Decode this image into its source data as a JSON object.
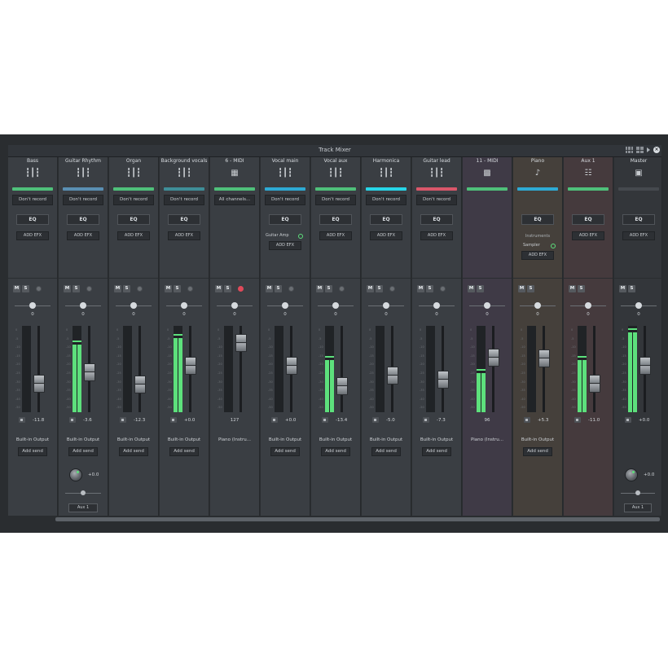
{
  "window": {
    "title": "Track Mixer"
  },
  "colors": {
    "accent_green": "#5de07c",
    "window_bg": "#2a2d30",
    "strip_bg": "#3a3e43"
  },
  "strips": [
    {
      "name": "Bass",
      "icon": "waveform-icon",
      "color": "#4fc07a",
      "record": "Don't record",
      "efx": [],
      "add_efx": "ADD EFX",
      "pan": "0",
      "volume": "-11.8",
      "fader_pos": 0.3,
      "meter_level": 0.0,
      "output": "Built-in Output",
      "add_send": "Add send"
    },
    {
      "name": "Guitar Rhythm",
      "icon": "waveform-icon",
      "color": "#5a8fb3",
      "record": "Don't record",
      "efx": [],
      "add_efx": "ADD EFX",
      "pan": "0",
      "volume": "-3.6",
      "fader_pos": 0.47,
      "meter_level": 0.78,
      "output": "Built-in Output",
      "add_send": "Add send",
      "aux_send": {
        "value": "+0.0",
        "destination": "Aux 1"
      }
    },
    {
      "name": "Organ",
      "icon": "waveform-icon",
      "color": "#4fc07a",
      "record": "Don't record",
      "efx": [],
      "add_efx": "ADD EFX",
      "pan": "0",
      "volume": "-12.3",
      "fader_pos": 0.29,
      "meter_level": 0.0,
      "output": "Built-in Output",
      "add_send": "Add send"
    },
    {
      "name": "Background vocals",
      "icon": "waveform-icon",
      "color": "#3f8e98",
      "record": "Don't record",
      "efx": [],
      "add_efx": "ADD EFX",
      "pan": "0",
      "volume": "+0.0",
      "fader_pos": 0.56,
      "meter_level": 0.86,
      "output": "Built-in Output",
      "add_send": "Add send"
    },
    {
      "name": "6 - MIDI",
      "icon": "piano-keys-icon",
      "color": "#4fc07a",
      "record": "All channels...",
      "efx": [],
      "add_efx": "",
      "pan": "0",
      "volume": "127",
      "fader_pos": 0.88,
      "meter_level": 0.0,
      "output": "Piano (Instru...",
      "add_send": "",
      "rec_armed": true
    },
    {
      "name": "Vocal main",
      "icon": "waveform-icon",
      "color": "#2eaad4",
      "record": "Don't record",
      "efx": [
        "Guitar Amp"
      ],
      "add_efx": "ADD EFX",
      "pan": "0",
      "volume": "+0.0",
      "fader_pos": 0.56,
      "meter_level": 0.0,
      "output": "Built-in Output",
      "add_send": "Add send"
    },
    {
      "name": "Vocal aux",
      "icon": "waveform-icon",
      "color": "#4fc07a",
      "record": "Don't record",
      "efx": [],
      "add_efx": "ADD EFX",
      "pan": "0",
      "volume": "-13.4",
      "fader_pos": 0.27,
      "meter_level": 0.6,
      "output": "Built-in Output",
      "add_send": "Add send"
    },
    {
      "name": "Harmonica",
      "icon": "waveform-icon",
      "color": "#27d6e8",
      "record": "Don't record",
      "efx": [],
      "add_efx": "ADD EFX",
      "pan": "0",
      "volume": "-5.0",
      "fader_pos": 0.42,
      "meter_level": 0.0,
      "output": "Built-in Output",
      "add_send": "Add send"
    },
    {
      "name": "Guitar lead",
      "icon": "waveform-icon",
      "color": "#d9576a",
      "record": "Don't record",
      "efx": [],
      "add_efx": "ADD EFX",
      "pan": "0",
      "volume": "-7.3",
      "fader_pos": 0.36,
      "meter_level": 0.0,
      "output": "Built-in Output",
      "add_send": "Add send"
    },
    {
      "name": "11 - MIDI",
      "icon": "midi-grid-icon",
      "color": "#4fc07a",
      "record": "",
      "efx": [],
      "add_efx": "",
      "pan": "0",
      "volume": "96",
      "fader_pos": 0.68,
      "meter_level": 0.45,
      "output": "Piano (Instru...",
      "add_send": ""
    },
    {
      "name": "Piano",
      "icon": "music-note-icon",
      "color": "#2eaad4",
      "record": "",
      "efx": [],
      "instruments_label": "Instruments",
      "instrument": "Sampler",
      "add_efx": "ADD EFX",
      "pan": "0",
      "volume": "+5.3",
      "fader_pos": 0.66,
      "meter_level": 0.0,
      "output": "Built-in Output",
      "add_send": "Add send"
    },
    {
      "name": "Aux 1",
      "icon": "aux-bus-icon",
      "color": "#4fc07a",
      "record": "",
      "efx": [],
      "add_efx": "ADD EFX",
      "pan": "0",
      "volume": "-11.0",
      "fader_pos": 0.3,
      "meter_level": 0.6,
      "output": "",
      "add_send": ""
    },
    {
      "name": "Master",
      "icon": "speaker-icon",
      "color": "#45494e",
      "record": "",
      "efx": [],
      "add_efx": "ADD EFX",
      "pan": "0",
      "volume": "+0.0",
      "fader_pos": 0.56,
      "meter_level": 0.92,
      "output": "",
      "add_send": "",
      "aux_send": {
        "value": "+0.0",
        "destination": "Aux 1"
      }
    }
  ],
  "meter_scale": [
    "0",
    "-5",
    "-10",
    "-15",
    "-20",
    "-25",
    "-30",
    "-35",
    "-40",
    "-50"
  ]
}
